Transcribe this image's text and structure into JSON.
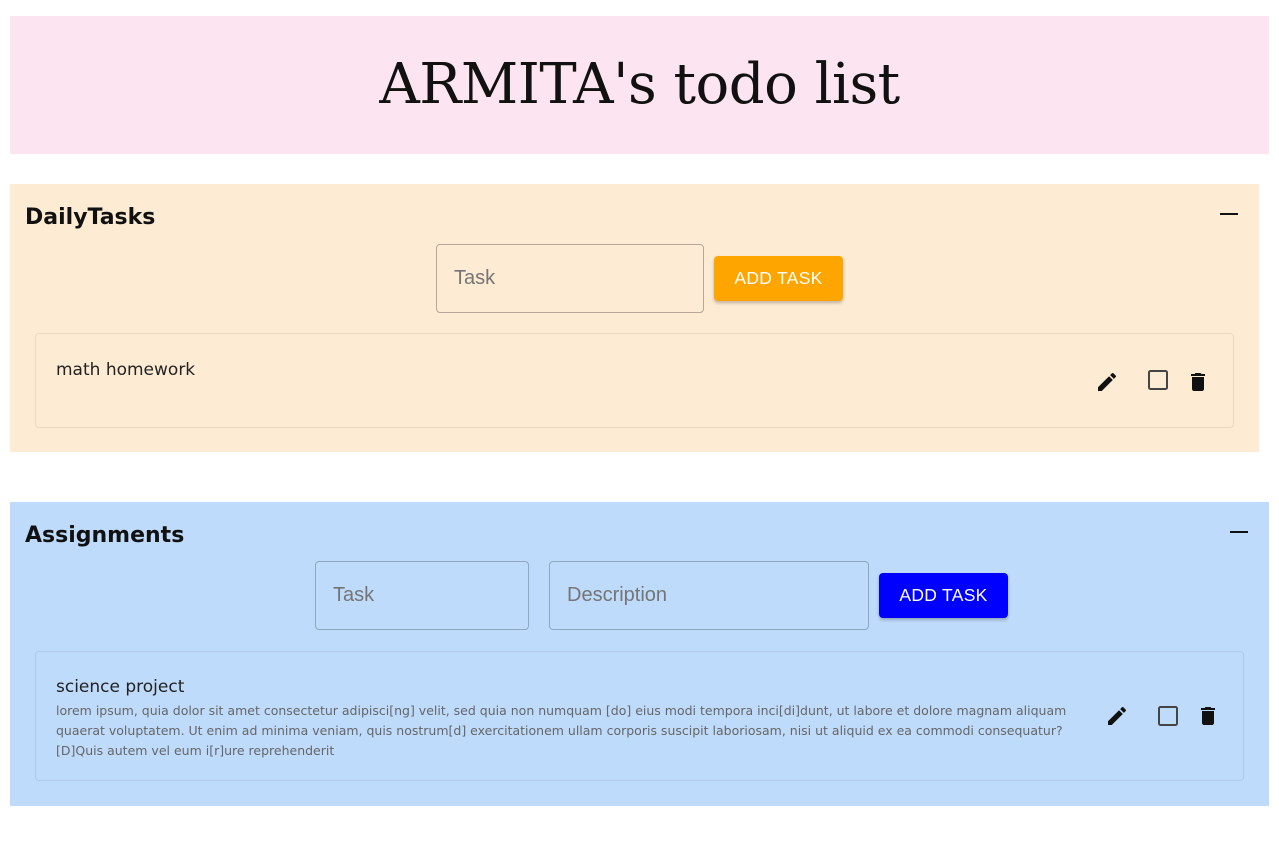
{
  "header": {
    "title": "ARMITA's todo list"
  },
  "daily": {
    "title": "DailyTasks",
    "task_placeholder": "Task",
    "add_label": "ADD TASK",
    "tasks": [
      {
        "title": "math homework"
      }
    ]
  },
  "assignments": {
    "title": "Assignments",
    "task_placeholder": "Task",
    "description_placeholder": "Description",
    "add_label": "ADD TASK",
    "tasks": [
      {
        "title": "science project",
        "description": "lorem ipsum, quia dolor sit amet consectetur adipisci[ng] velit, sed quia non numquam [do] eius modi tempora inci[di]dunt, ut labore et dolore magnam aliquam quaerat voluptatem. Ut enim ad minima veniam, quis nostrum[d] exercitationem ullam corporis suscipit laboriosam, nisi ut aliquid ex ea commodi consequatur? [D]Quis autem vel eum i[r]ure reprehenderit"
      }
    ]
  },
  "icons": {
    "collapse": "minus-icon",
    "edit": "pencil-icon",
    "complete": "checkbox-outline-icon",
    "delete": "trash-icon"
  },
  "colors": {
    "header_bg": "#fce4f0",
    "daily_bg": "#fdebd3",
    "assignments_bg": "#bfdbfc",
    "daily_accent": "#ffa500",
    "assignments_accent": "#0000ff"
  }
}
